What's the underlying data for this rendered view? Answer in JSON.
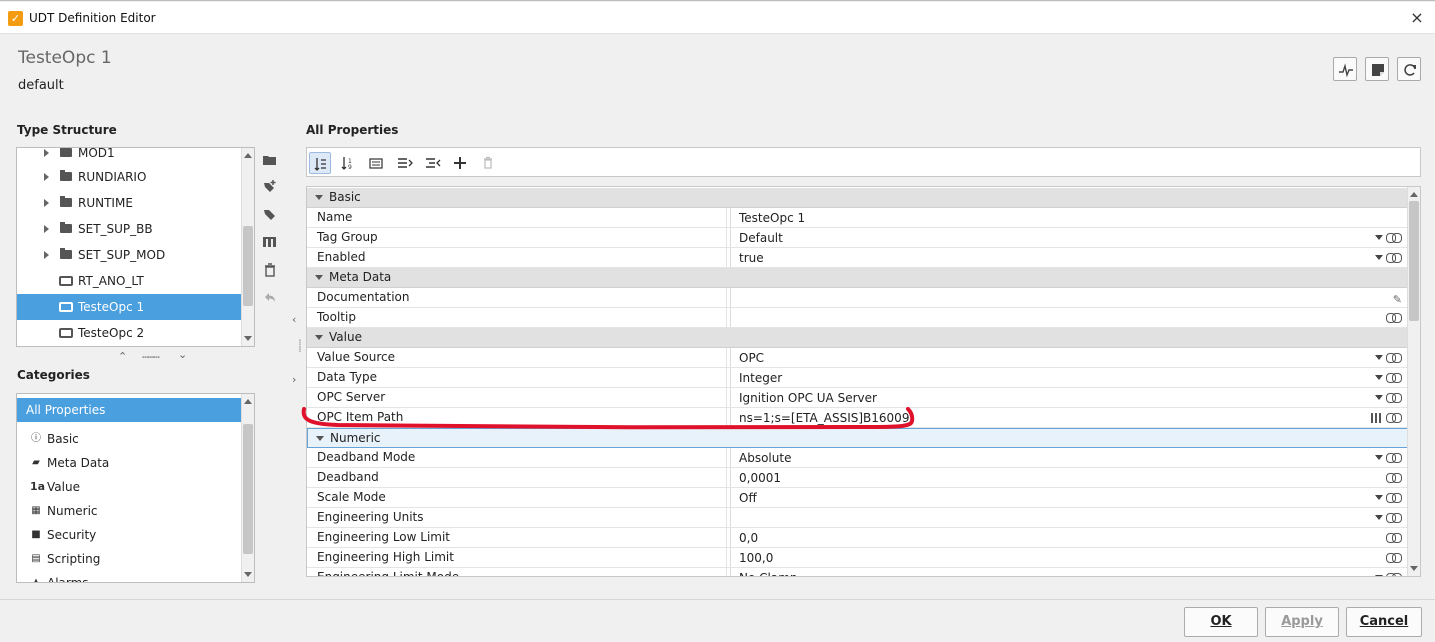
{
  "window": {
    "title": "UDT Definition Editor",
    "close_label": "×"
  },
  "header": {
    "title": "TesteOpc 1",
    "subtitle": "default"
  },
  "type_structure": {
    "label": "Type Structure",
    "items": [
      {
        "label": "MOD1",
        "kind": "folder"
      },
      {
        "label": "RUNDIARIO",
        "kind": "folder"
      },
      {
        "label": "RUNTIME",
        "kind": "folder"
      },
      {
        "label": "SET_SUP_BB",
        "kind": "folder"
      },
      {
        "label": "SET_SUP_MOD",
        "kind": "folder"
      },
      {
        "label": "RT_ANO_LT",
        "kind": "udt"
      },
      {
        "label": "TesteOpc 1",
        "kind": "udt",
        "selected": true
      },
      {
        "label": "TesteOpc 2",
        "kind": "udt"
      }
    ]
  },
  "categories": {
    "label": "Categories",
    "items": [
      {
        "label": "All Properties",
        "icon": "",
        "selected": true
      },
      {
        "label": "Basic",
        "icon": "info-icon"
      },
      {
        "label": "Meta Data",
        "icon": "tag-icon"
      },
      {
        "label": "Value",
        "icon": "value-icon"
      },
      {
        "label": "Numeric",
        "icon": "calculator-icon"
      },
      {
        "label": "Security",
        "icon": "lock-icon"
      },
      {
        "label": "Scripting",
        "icon": "script-icon"
      },
      {
        "label": "Alarms",
        "icon": "bell-icon"
      }
    ]
  },
  "properties": {
    "label": "All Properties",
    "rows": [
      {
        "type": "category",
        "name": "Basic"
      },
      {
        "name": "Name",
        "value": "TesteOpc 1",
        "icons": []
      },
      {
        "name": "Tag Group",
        "value": "Default",
        "icons": [
          "dropdown",
          "link"
        ]
      },
      {
        "name": "Enabled",
        "value": "true",
        "icons": [
          "dropdown",
          "link"
        ]
      },
      {
        "type": "category",
        "name": "Meta Data"
      },
      {
        "name": "Documentation",
        "value": "",
        "icons": [
          "pencil"
        ]
      },
      {
        "name": "Tooltip",
        "value": "",
        "icons": [
          "link"
        ]
      },
      {
        "type": "category",
        "name": "Value"
      },
      {
        "name": "Value Source",
        "value": "OPC",
        "icons": [
          "dropdown",
          "link"
        ]
      },
      {
        "name": "Data Type",
        "value": "Integer",
        "icons": [
          "dropdown",
          "link"
        ]
      },
      {
        "name": "OPC Server",
        "value": "Ignition OPC UA Server",
        "icons": [
          "dropdown",
          "link"
        ]
      },
      {
        "name": "OPC Item Path",
        "value": "ns=1;s=[ETA_ASSIS]B16009",
        "icons": [
          "browse",
          "link"
        ]
      },
      {
        "type": "category",
        "name": "Numeric",
        "highlighted": true
      },
      {
        "name": "Deadband Mode",
        "value": "Absolute",
        "icons": [
          "dropdown",
          "link"
        ]
      },
      {
        "name": "Deadband",
        "value": "0,0001",
        "icons": [
          "link"
        ]
      },
      {
        "name": "Scale Mode",
        "value": "Off",
        "icons": [
          "dropdown",
          "link"
        ]
      },
      {
        "name": "Engineering Units",
        "value": "",
        "icons": [
          "dropdown",
          "link"
        ]
      },
      {
        "name": "Engineering Low Limit",
        "value": "0,0",
        "icons": [
          "link"
        ]
      },
      {
        "name": "Engineering High Limit",
        "value": "100,0",
        "icons": [
          "link"
        ]
      },
      {
        "name": "Engineering Limit Mode",
        "value": "No Clamp",
        "icons": [
          "dropdown",
          "link"
        ]
      }
    ]
  },
  "footer": {
    "ok": "OK",
    "apply": "Apply",
    "cancel": "Cancel"
  },
  "colors": {
    "selection": "#4a9fdf",
    "annotation": "#e0112b"
  }
}
